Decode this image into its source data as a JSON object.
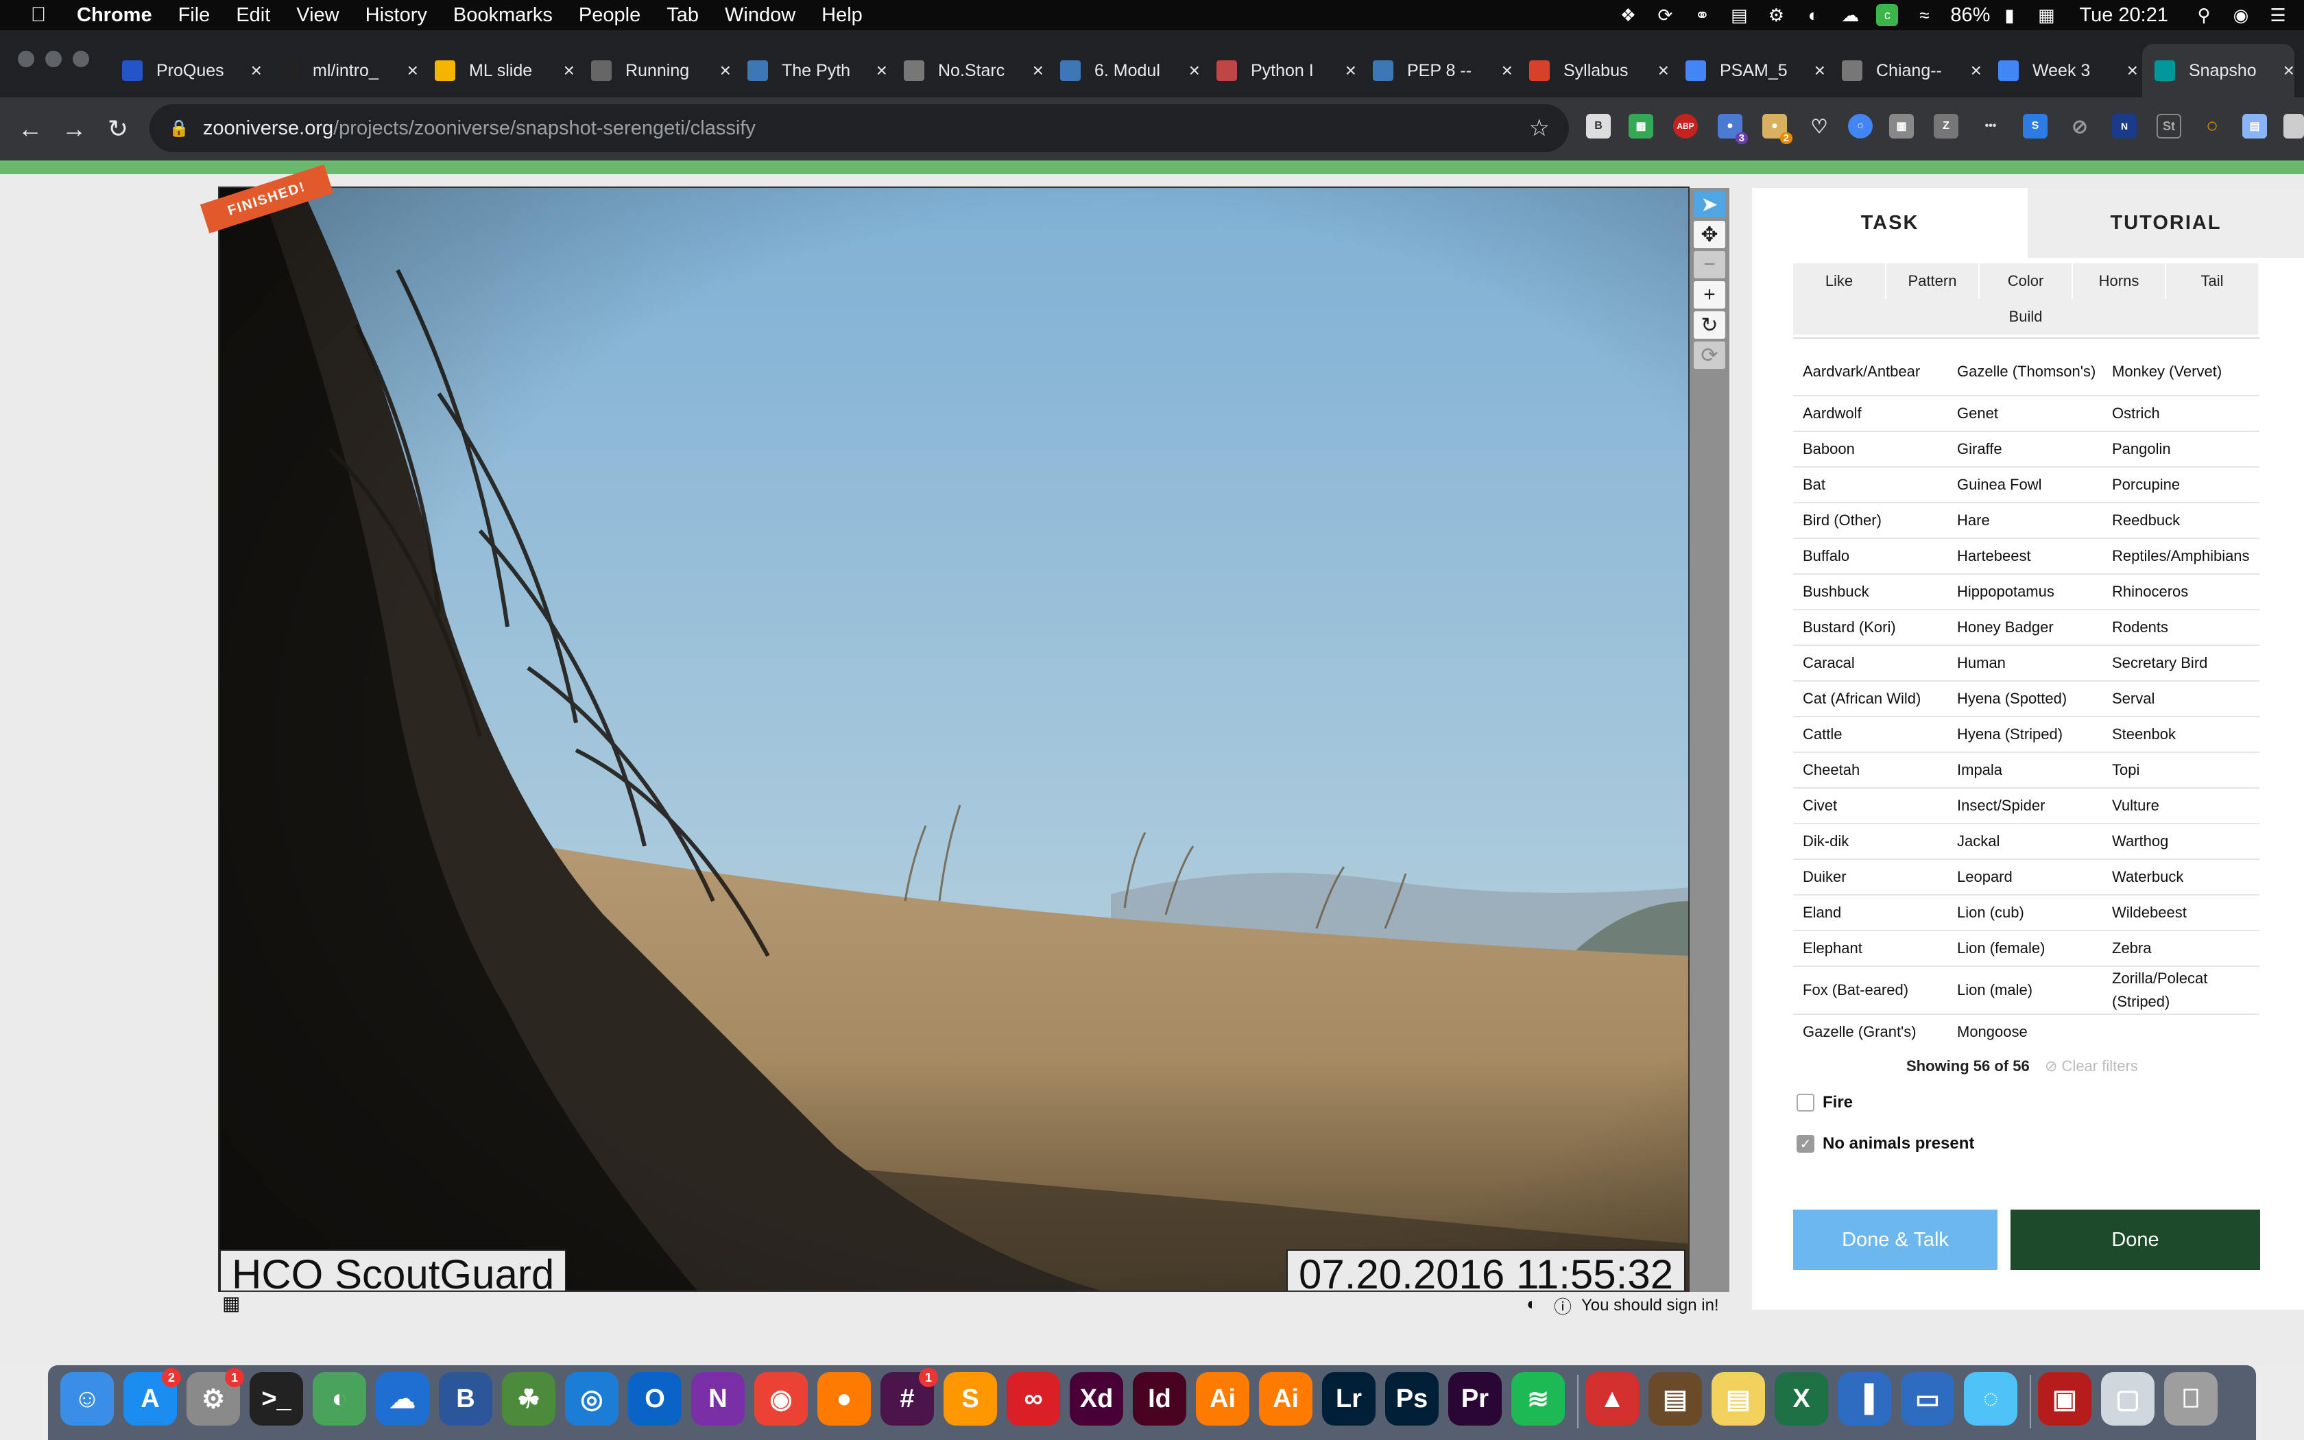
{
  "menubar": {
    "app": "Chrome",
    "items": [
      "File",
      "Edit",
      "View",
      "History",
      "Bookmarks",
      "People",
      "Tab",
      "Window",
      "Help"
    ],
    "battery": "86%",
    "clock": "Tue 20:21"
  },
  "tabs": [
    {
      "title": "ProQues",
      "color": "#2355c9"
    },
    {
      "title": "ml/intro_",
      "color": "#222222"
    },
    {
      "title": "ML slide",
      "color": "#f4b400"
    },
    {
      "title": "Running",
      "color": "#666666"
    },
    {
      "title": "The Pyth",
      "color": "#3d78b5"
    },
    {
      "title": "No.Starc",
      "color": "#777777"
    },
    {
      "title": "6. Modul",
      "color": "#3d78b5"
    },
    {
      "title": "Python I",
      "color": "#c04545"
    },
    {
      "title": "PEP 8 --",
      "color": "#3d78b5"
    },
    {
      "title": "Syllabus",
      "color": "#d9402b"
    },
    {
      "title": "PSAM_5",
      "color": "#4285f4"
    },
    {
      "title": "Chiang--",
      "color": "#777777"
    },
    {
      "title": "Week 3",
      "color": "#4285f4"
    },
    {
      "title": "Snapsho",
      "color": "#00979d"
    }
  ],
  "toolbar": {
    "url_host": "zooniverse.org",
    "url_path": "/projects/zooniverse/snapshot-serengeti/classify"
  },
  "viewer": {
    "finished_label": "FINISHED!",
    "camera_label": "HCO ScoutGuard",
    "timestamp": "07.20.2016 11:55:32",
    "sign_in_text": "You should sign in!"
  },
  "panel": {
    "task_tab": "TASK",
    "tutorial_tab": "TUTORIAL",
    "filters": [
      "Like",
      "Pattern",
      "Color",
      "Horns",
      "Tail",
      "Build"
    ],
    "species_col1": [
      "Aardvark/Antbear",
      "Aardwolf",
      "Baboon",
      "Bat",
      "Bird (Other)",
      "Buffalo",
      "Bushbuck",
      "Bustard (Kori)",
      "Caracal",
      "Cat (African Wild)",
      "Cattle",
      "Cheetah",
      "Civet",
      "Dik-dik",
      "Duiker",
      "Eland",
      "Elephant",
      "Fox (Bat-eared)",
      "Gazelle (Grant's)"
    ],
    "species_col2": [
      "Gazelle (Thomson's)",
      "Genet",
      "Giraffe",
      "Guinea Fowl",
      "Hare",
      "Hartebeest",
      "Hippopotamus",
      "Honey Badger",
      "Human",
      "Hyena (Spotted)",
      "Hyena (Striped)",
      "Impala",
      "Insect/Spider",
      "Jackal",
      "Leopard",
      "Lion (cub)",
      "Lion (female)",
      "Lion (male)",
      "Mongoose"
    ],
    "species_col3": [
      "Monkey (Vervet)",
      "Ostrich",
      "Pangolin",
      "Porcupine",
      "Reedbuck",
      "Reptiles/Amphibians",
      "Rhinoceros",
      "Rodents",
      "Secretary Bird",
      "Serval",
      "Steenbok",
      "Topi",
      "Vulture",
      "Warthog",
      "Waterbuck",
      "Wildebeest",
      "Zebra",
      "Zorilla/Polecat (Striped)"
    ],
    "showing": "Showing 56 of 56",
    "clear_filters": "Clear filters",
    "fire_label": "Fire",
    "fire_checked": false,
    "no_animals_label": "No animals present",
    "no_animals_checked": true,
    "done_talk": "Done & Talk",
    "done": "Done",
    "done_talk_color": "#6cb8ee",
    "done_color": "#1c4a2b"
  },
  "dock": {
    "apps": [
      "Finder",
      "App Store",
      "System Preferences",
      "Terminal",
      "Maps",
      "OneDrive",
      "Word",
      "Keynote",
      "Safari",
      "Outlook",
      "OneNote",
      "Chrome",
      "Firefox",
      "Slack",
      "Sublime Text",
      "Creative Cloud",
      "Xd",
      "Id",
      "Ai",
      "Ai",
      "Lr",
      "Ps",
      "Pr",
      "Spotify",
      "Acrobat",
      "Books",
      "Stickies",
      "Excel",
      "Charts",
      "Keynote",
      "Messages",
      "Photo Booth",
      "Preview",
      "Trash"
    ]
  }
}
